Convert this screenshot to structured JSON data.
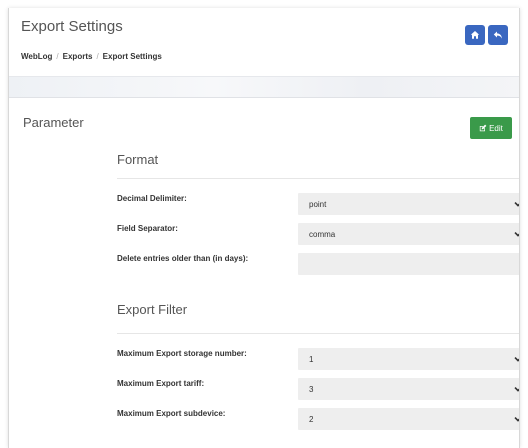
{
  "header": {
    "title": "Export Settings",
    "breadcrumb": [
      "WebLog",
      "Exports",
      "Export Settings"
    ],
    "home_icon": "home-icon",
    "back_icon": "reply-icon",
    "button_color": "#3a67c0"
  },
  "panel": {
    "heading": "Parameter",
    "edit_label": "Edit",
    "edit_icon": "pencil-square-icon",
    "edit_color": "#3a9a4a"
  },
  "format": {
    "title": "Format",
    "fields": [
      {
        "label": "Decimal Delimiter:",
        "value": "point",
        "type": "select"
      },
      {
        "label": "Field Separator:",
        "value": "comma",
        "type": "select"
      },
      {
        "label": "Delete entries older than (in days):",
        "value": "",
        "type": "input"
      }
    ]
  },
  "export_filter": {
    "title": "Export Filter",
    "fields": [
      {
        "label": "Maximum Export storage number:",
        "value": "1",
        "type": "select"
      },
      {
        "label": "Maximum Export tariff:",
        "value": "3",
        "type": "select"
      },
      {
        "label": "Maximum Export subdevice:",
        "value": "2",
        "type": "select"
      }
    ]
  }
}
